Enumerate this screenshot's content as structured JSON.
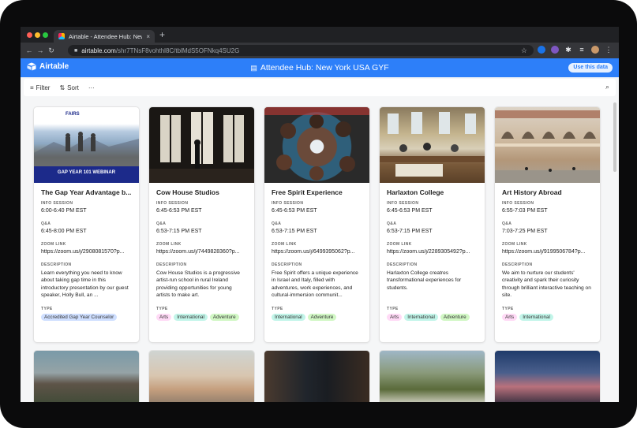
{
  "browser": {
    "tab_title": "Airtable - Attendee Hub: New Y",
    "tab_close": "×",
    "new_tab": "+",
    "url_host": "airtable.com",
    "url_path": "/shr7TNsF8vohthl8C/tblMdS5OFNkq4SU2G"
  },
  "app": {
    "brand": "Airtable",
    "base_title": "Attendee Hub: New York USA GYF",
    "use_data_label": "Use this data"
  },
  "viewbar": {
    "filter_label": "Filter",
    "sort_label": "Sort",
    "more_label": "···"
  },
  "field_labels": {
    "info": "INFO SESSION",
    "qa": "Q&A",
    "zoom": "ZOOM LINK",
    "desc": "DESCRIPTION",
    "type": "TYPE"
  },
  "cards": [
    {
      "title": "The Gap Year Advantage b...",
      "image_caption": "GAP YEAR 101 WEBINAR",
      "image_logo": "FAIRS",
      "info_session": "6:00-6:40 PM EST",
      "qa": "6:45-8:00 PM EST",
      "zoom_link": "https://zoom.us/j/2908081570?p...",
      "description": "Learn everything you need to know about taking gap time in this introductory presentation by our guest speaker, Holly Bull, an ...",
      "types": [
        "Accredited Gap Year Counselor"
      ]
    },
    {
      "title": "Cow House Studios",
      "info_session": "6:45-6:53 PM EST",
      "qa": "6:53-7:15 PM EST",
      "zoom_link": "https://zoom.us/j/7449828360?p...",
      "description": "Cow House Studios is a progressive artist-run school in rural Ireland providing opportunities for young artists to make art.",
      "types": [
        "Arts",
        "International",
        "Adventure"
      ]
    },
    {
      "title": "Free Spirit Experience",
      "info_session": "6:45-6:53 PM EST",
      "qa": "6:53-7:15 PM EST",
      "zoom_link": "https://zoom.us/j/6499395062?p...",
      "description": "Free Spirit offers a unique experience in Israel and Italy, filled with adventures, work experiences, and cultural-immersion communit...",
      "types": [
        "International",
        "Adventure"
      ]
    },
    {
      "title": "Harlaxton College",
      "info_session": "6:45-6:53 PM EST",
      "qa": "6:53-7:15 PM EST",
      "zoom_link": "https://zoom.us/j/2289305492?p...",
      "description": "Harlaxton College creatres transformational experiences for students.",
      "types": [
        "Arts",
        "International",
        "Adventure"
      ]
    },
    {
      "title": "Art History Abroad",
      "info_session": "6:55-7:03 PM EST",
      "qa": "7:03-7:25 PM EST",
      "zoom_link": "https://zoom.us/j/9199506784?p...",
      "description": "We aim to nurture our students' creativity and spark their curiosity through brilliant interactive teaching on site.",
      "types": [
        "Arts",
        "International"
      ]
    }
  ],
  "tag_colors": {
    "Accredited Gap Year Counselor": "blue",
    "Arts": "pink",
    "International": "cyan",
    "Adventure": "green"
  },
  "colors": {
    "airtable_blue": "#2d7ff9"
  },
  "icons": {
    "filter": "≡",
    "sort": "⇅",
    "search": "⌕",
    "star": "☆",
    "lock": "🔒",
    "base": "▤"
  }
}
